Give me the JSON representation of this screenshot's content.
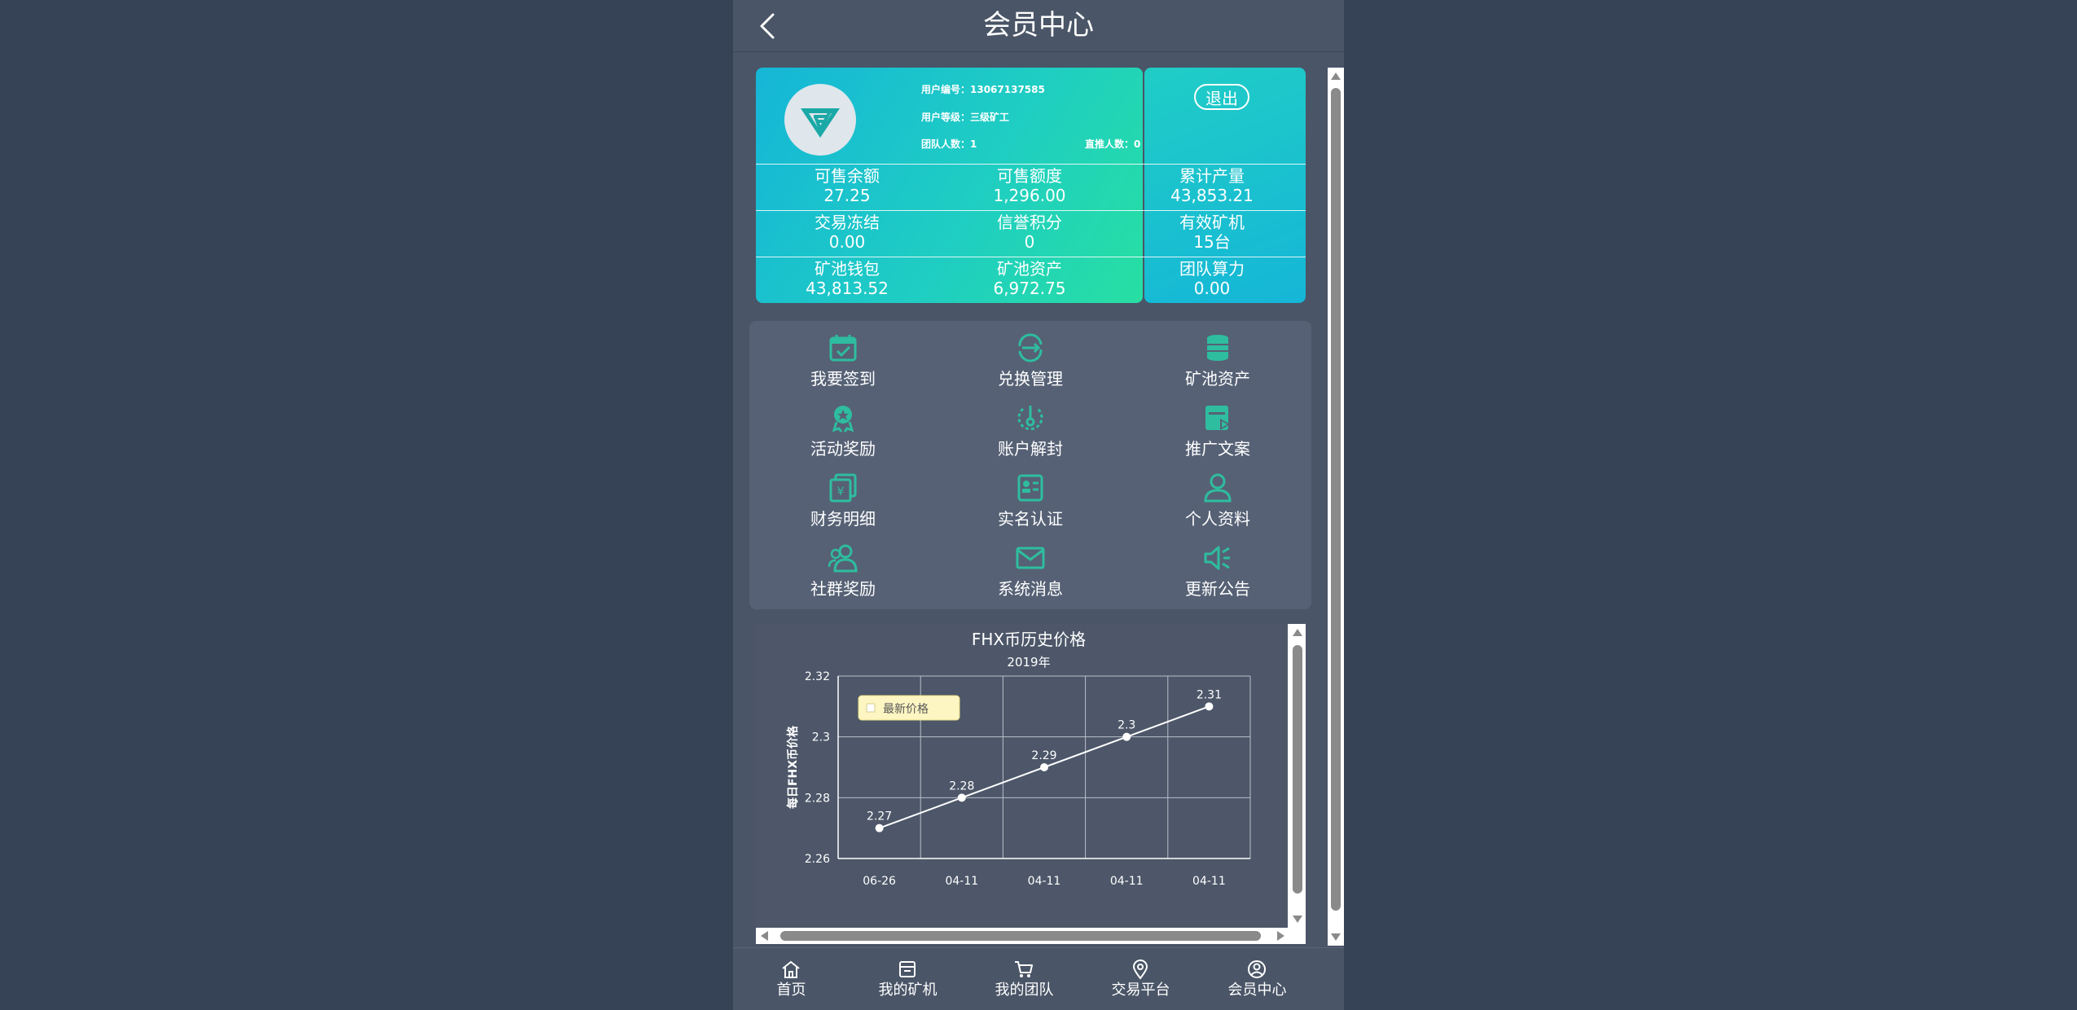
{
  "header": {
    "title": "会员中心"
  },
  "user": {
    "id_line": "用户编号：13067137585",
    "level_line": "用户等级：三级矿工",
    "team_line": "团队人数：1",
    "direct_line": "直推人数：0",
    "logout_label": "退出"
  },
  "stats": [
    {
      "label": "可售余额",
      "value": "27.25"
    },
    {
      "label": "可售额度",
      "value": "1,296.00"
    },
    {
      "label": "累计产量",
      "value": "43,853.21"
    },
    {
      "label": "交易冻结",
      "value": "0.00"
    },
    {
      "label": "信誉积分",
      "value": "0"
    },
    {
      "label": "有效矿机",
      "value": "15台"
    },
    {
      "label": "矿池钱包",
      "value": "43,813.52"
    },
    {
      "label": "矿池资产",
      "value": "6,972.75"
    },
    {
      "label": "团队算力",
      "value": "0.00"
    }
  ],
  "menu": [
    {
      "label": "我要签到",
      "icon": "calendar-check-icon"
    },
    {
      "label": "兑换管理",
      "icon": "exchange-icon"
    },
    {
      "label": "矿池资产",
      "icon": "coin-stack-icon"
    },
    {
      "label": "活动奖励",
      "icon": "award-icon"
    },
    {
      "label": "账户解封",
      "icon": "unlock-icon"
    },
    {
      "label": "推广文案",
      "icon": "share-doc-icon"
    },
    {
      "label": "财务明细",
      "icon": "finance-icon"
    },
    {
      "label": "实名认证",
      "icon": "id-card-icon"
    },
    {
      "label": "个人资料",
      "icon": "user-icon"
    },
    {
      "label": "社群奖励",
      "icon": "group-icon"
    },
    {
      "label": "系统消息",
      "icon": "mail-icon"
    },
    {
      "label": "更新公告",
      "icon": "speaker-icon"
    }
  ],
  "chart_data": {
    "type": "line",
    "title": "FHX币历史价格",
    "subtitle": "2019年",
    "ylabel": "每日FHX币价格",
    "xlabel": "",
    "categories": [
      "06-26",
      "04-11",
      "04-11",
      "04-11",
      "04-11"
    ],
    "series": [
      {
        "name": "最新价格",
        "values": [
          2.27,
          2.28,
          2.29,
          2.3,
          2.31
        ]
      }
    ],
    "data_labels": [
      "2.27",
      "2.28",
      "2.29",
      "2.3",
      "2.31"
    ],
    "y_ticks": [
      "2.26",
      "2.28",
      "2.3",
      "2.32"
    ],
    "ylim": [
      2.26,
      2.32
    ],
    "grid": true,
    "legend": "top-left",
    "colors": {
      "line": "#ffffff",
      "legend_bg": "#fdf6c3"
    }
  },
  "tabs": [
    {
      "label": "首页",
      "icon": "home-icon"
    },
    {
      "label": "我的矿机",
      "icon": "store-icon"
    },
    {
      "label": "我的团队",
      "icon": "cart-icon"
    },
    {
      "label": "交易平台",
      "icon": "location-icon"
    },
    {
      "label": "会员中心",
      "icon": "user-circle-icon"
    }
  ],
  "colors": {
    "background": "#364356",
    "panel": "#4a5567",
    "menu": "#566175",
    "accent": "#2ebd9f",
    "card_start": "#15b6d7",
    "card_end": "#27dfa2"
  }
}
